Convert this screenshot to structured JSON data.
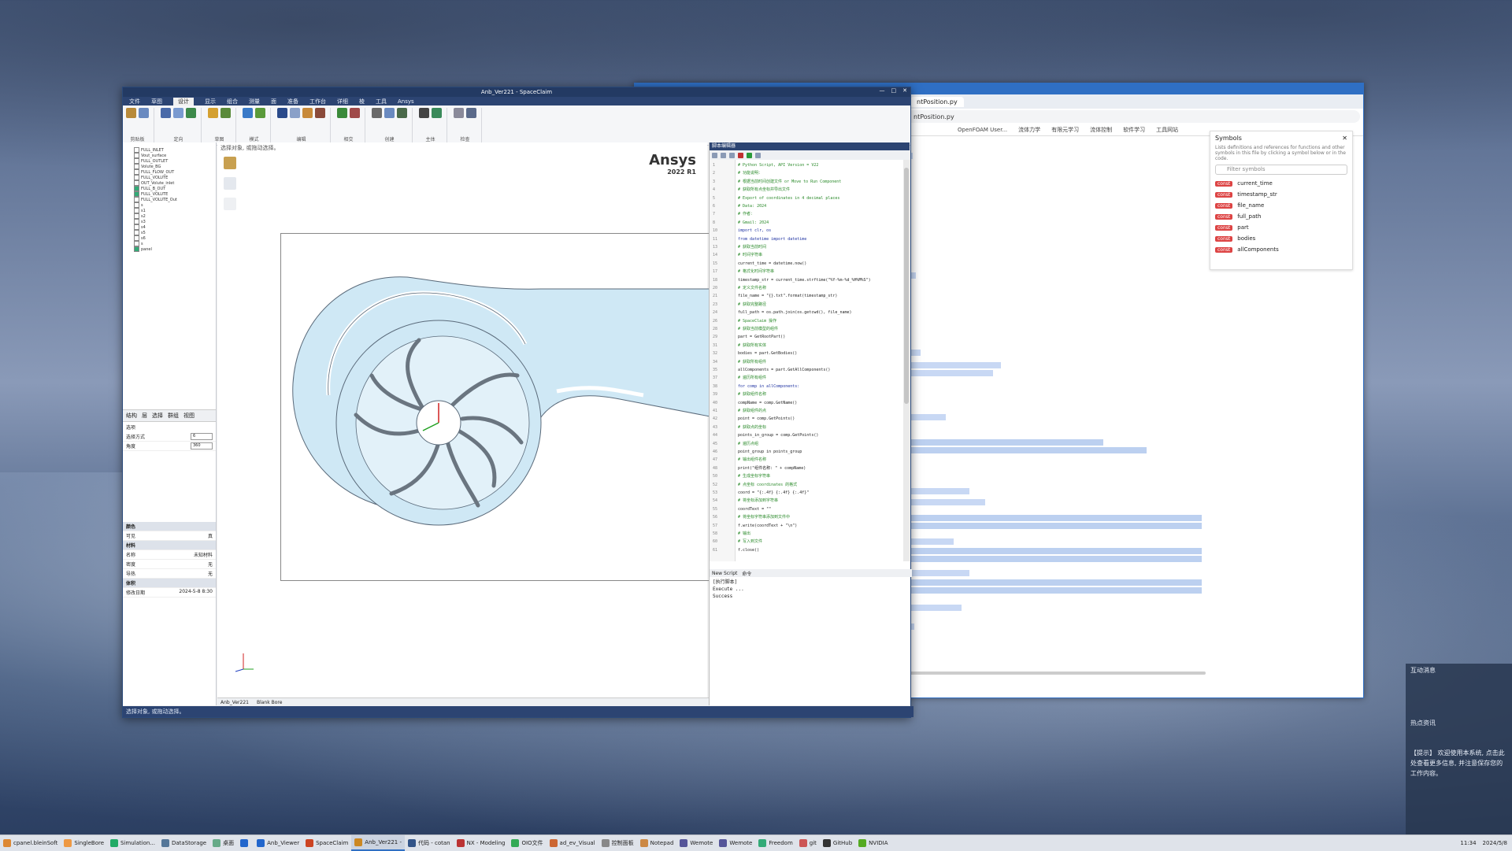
{
  "browser": {
    "tab_title": "ntPosition.py",
    "bookmarks": [
      "OpenFOAM User...",
      "流体力学",
      "有限元学习",
      "流体控制",
      "软件学习",
      "工具网站"
    ],
    "symbols": {
      "title": "Symbols",
      "description": "Lists definitions and references for functions and other symbols in this file by clicking a symbol below or in the code.",
      "filter_placeholder": "Filter symbols",
      "items": [
        "current_time",
        "timestamp_str",
        "file_name",
        "full_path",
        "part",
        "bodies",
        "allComponents"
      ]
    }
  },
  "spaceclaim": {
    "title": "Anb_Ver221 - SpaceClaim",
    "menu": [
      "文件",
      "草图",
      "设计",
      "显示",
      "组合",
      "测量",
      "面",
      "准备",
      "工作台",
      "详细",
      "棱",
      "工具",
      "Ansys"
    ],
    "active_menu": "设计",
    "ribbon_groups": [
      "剪贴板",
      "定向",
      "草图",
      "模式",
      "编辑",
      "相交",
      "创建",
      "主体",
      "检查"
    ],
    "viewport_hint": "选择对象, 或拖动选择。",
    "ansys_brand": "Ansys",
    "ansys_version": "2022 R1",
    "tree_items": [
      "FULL_INLET",
      "Vout_surface",
      "FULL_OUTLET",
      "Volute_BG",
      "FULL_FLOW_OUT",
      "FULL_VOLUTE",
      "OUT_Volute_inlet",
      "FULL_B_OUT",
      "FULL_VOLUTE",
      "FULL_VOLUTE_Out",
      "s",
      "s1",
      "s2",
      "s3",
      "s4",
      "s5",
      "s6",
      "s",
      "panel"
    ],
    "panel_tabs": [
      "结构",
      "层",
      "选择",
      "群组",
      "视图"
    ],
    "options_label": "选项",
    "option_fields": [
      {
        "label": "选择方式",
        "value": "6"
      },
      {
        "label": "角度",
        "value": "360"
      }
    ],
    "properties": [
      {
        "k": "颜色",
        "v": ""
      },
      {
        "k": "可见",
        "v": "真"
      },
      {
        "k": "材料",
        "v": ""
      },
      {
        "k": "名称",
        "v": "未知材料"
      },
      {
        "k": "密度",
        "v": "无"
      },
      {
        "k": "导热",
        "v": "无"
      },
      {
        "k": "体积",
        "v": ""
      },
      {
        "k": "修改日期",
        "v": "2024-5-8 8:30"
      }
    ],
    "viewport_tabs": [
      "Anb_Ver221",
      "Blank Bore"
    ],
    "status_text": "选择对象, 或拖动选择。"
  },
  "script_editor": {
    "title": "脚本编辑器",
    "lines": [
      {
        "n": 1,
        "t": "# Python Script, API Version = V22",
        "c": "cm"
      },
      {
        "n": 2,
        "t": "# 功能说明：",
        "c": "cm"
      },
      {
        "n": 3,
        "t": "# 根据当前时间创建文件 or Move to Run Component",
        "c": "cm"
      },
      {
        "n": 4,
        "t": "# 获取所有点坐标并导出文件",
        "c": "cm"
      },
      {
        "n": 5,
        "t": "# Export of coordinates in 4 decimal places",
        "c": "cm"
      },
      {
        "n": 6,
        "t": "# Data: 2024",
        "c": "cm"
      },
      {
        "n": 7,
        "t": "# 作者：",
        "c": "cm"
      },
      {
        "n": 8,
        "t": "# Gmail: 2024",
        "c": "cm"
      },
      {
        "n": 10,
        "t": "import clr, os",
        "c": "kw"
      },
      {
        "n": 11,
        "t": "from datetime import datetime",
        "c": "kw"
      },
      {
        "n": 13,
        "t": "# 获取当前时间",
        "c": "cm"
      },
      {
        "n": 14,
        "t": "# 时间字符串",
        "c": "cm"
      },
      {
        "n": 15,
        "t": "current_time = datetime.now()",
        "c": "tx"
      },
      {
        "n": 17,
        "t": "# 格式化时间字符串",
        "c": "cm"
      },
      {
        "n": 18,
        "t": "timestamp_str = current_time.strftime(\"%Y-%m-%d_%H%M%S\")",
        "c": "tx"
      },
      {
        "n": 20,
        "t": "# 定义文件名称",
        "c": "cm"
      },
      {
        "n": 21,
        "t": "file_name = \"{}.txt\".format(timestamp_str)",
        "c": "tx"
      },
      {
        "n": 23,
        "t": "# 获取完整路径",
        "c": "cm"
      },
      {
        "n": 24,
        "t": "full_path = os.path.join(os.getcwd(), file_name)",
        "c": "tx"
      },
      {
        "n": 26,
        "t": "# SpaceClaim 操作",
        "c": "cm"
      },
      {
        "n": 28,
        "t": "# 获取当前模型的组件",
        "c": "cm"
      },
      {
        "n": 29,
        "t": "part = GetRootPart()",
        "c": "tx"
      },
      {
        "n": 31,
        "t": "# 获取所有实体",
        "c": "cm"
      },
      {
        "n": 32,
        "t": "bodies = part.GetBodies()",
        "c": "tx"
      },
      {
        "n": 34,
        "t": "# 获取所有组件",
        "c": "cm"
      },
      {
        "n": 35,
        "t": "allComponents = part.GetAllComponents()",
        "c": "tx"
      },
      {
        "n": 37,
        "t": "# 遍历所有组件",
        "c": "cm"
      },
      {
        "n": 38,
        "t": "for comp in allComponents:",
        "c": "kw"
      },
      {
        "n": 39,
        "t": "    # 获取组件名称",
        "c": "cm"
      },
      {
        "n": 40,
        "t": "    compName = comp.GetName()",
        "c": "tx"
      },
      {
        "n": 41,
        "t": "    # 获取组件的点",
        "c": "cm"
      },
      {
        "n": 42,
        "t": "    point = comp.GetPoints()",
        "c": "tx"
      },
      {
        "n": 43,
        "t": "    # 获取点的坐标",
        "c": "cm"
      },
      {
        "n": 44,
        "t": "    points_in_group = comp.GetPoints()",
        "c": "tx"
      },
      {
        "n": 45,
        "t": "    # 遍历点组",
        "c": "cm"
      },
      {
        "n": 46,
        "t": "    point_group in points_group",
        "c": "tx"
      },
      {
        "n": 47,
        "t": "    # 输出组件名称",
        "c": "cm"
      },
      {
        "n": 48,
        "t": "    print(\"组件名称: \" + compName)",
        "c": "tx"
      },
      {
        "n": 50,
        "t": "    # 生成坐标字符串",
        "c": "cm"
      },
      {
        "n": 52,
        "t": "    # 点坐标 coordinates 的格式",
        "c": "cm"
      },
      {
        "n": 53,
        "t": "    coord = \"{:.4f} {:.4f} {:.4f}\"",
        "c": "tx"
      },
      {
        "n": 54,
        "t": "    # 将坐标添加到字符串",
        "c": "cm"
      },
      {
        "n": 55,
        "t": "    coordText = \"\"",
        "c": "tx"
      },
      {
        "n": 56,
        "t": "    # 将坐标字符串添加到文件中",
        "c": "cm"
      },
      {
        "n": 57,
        "t": "    f.write(coordText + \"\\n\")",
        "c": "tx"
      },
      {
        "n": 58,
        "t": "    # 输出",
        "c": "cm"
      },
      {
        "n": 60,
        "t": "    # 写入到文件",
        "c": "cm"
      },
      {
        "n": 61,
        "t": "    f.close()",
        "c": "tx"
      }
    ],
    "bottom_tabs": [
      "New Script",
      "命令"
    ],
    "output_lines": [
      "[执行脚本]",
      "Execute ...",
      "Success"
    ]
  },
  "notification": {
    "title": "互动消息",
    "subtitle": "热点资讯",
    "body": "【提示】 欢迎使用本系统, 点击此处查看更多信息, 并注意保存您的工作内容。"
  },
  "taskbar": {
    "items": [
      "cpanel.bleinSoft",
      "SingleBore",
      "Simulation...",
      "DataStorage",
      "桌面",
      "",
      "Anb_Viewer",
      "SpaceClaim",
      "Anb_Ver221 -",
      "代码 - cotan",
      "NX - Modeling",
      "OIO文件",
      "ad_ev_Visual",
      "控制面板",
      "Notepad",
      "Wemote",
      "Wemote",
      "Freedom",
      "git",
      "GitHub",
      "NVIDIA"
    ],
    "active_index": 8,
    "clock": "11:34",
    "date": "2024/5/8"
  }
}
